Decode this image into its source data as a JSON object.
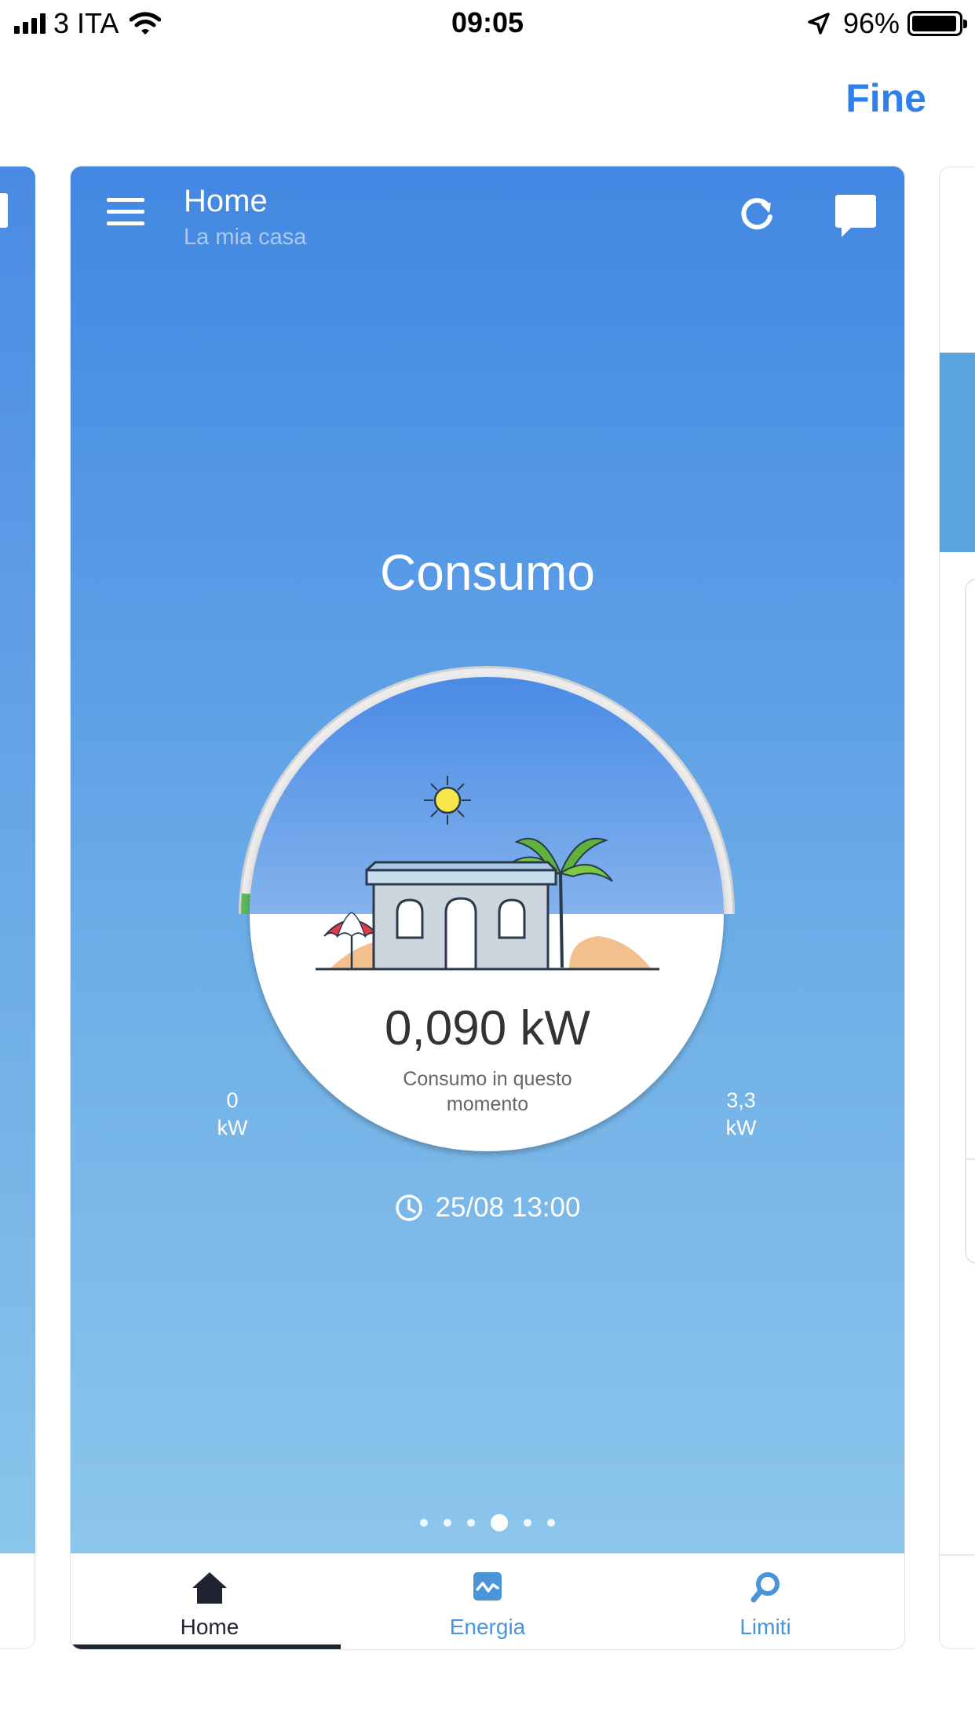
{
  "status_bar": {
    "carrier": "3 ITA",
    "time": "09:05",
    "battery_percent": "96%",
    "battery_level": 0.96,
    "icons": [
      "signal-icon",
      "wifi-icon",
      "location-arrow-icon",
      "battery-icon"
    ]
  },
  "nav": {
    "done_label": "Fine"
  },
  "card": {
    "header": {
      "title": "Home",
      "subtitle": "La mia casa"
    },
    "section_title": "Consumo",
    "gauge": {
      "min_value": "0",
      "min_unit": "kW",
      "max_value": "3,3",
      "max_unit": "kW",
      "current_fraction": 0.027,
      "track_color": "#e9e9e9",
      "fill_color": "#5cb85c"
    },
    "reading": "0,090 kW",
    "reading_caption": "Consumo in questo momento",
    "timestamp": "25/08 13:00",
    "pager": {
      "count": 6,
      "active_index": 3
    }
  },
  "tabbar": {
    "items": [
      {
        "label": "Home",
        "icon": "house-icon",
        "active": true
      },
      {
        "label": "Energia",
        "icon": "energy-chart-icon",
        "active": false
      },
      {
        "label": "Limiti",
        "icon": "search-icon",
        "active": false
      }
    ]
  },
  "colors": {
    "accent": "#2f80ed",
    "card_gradient_top": "#4287e2",
    "card_gradient_bottom": "#8cc6ec",
    "tab_inactive": "#4a95d8",
    "tab_active": "#1f2430"
  }
}
